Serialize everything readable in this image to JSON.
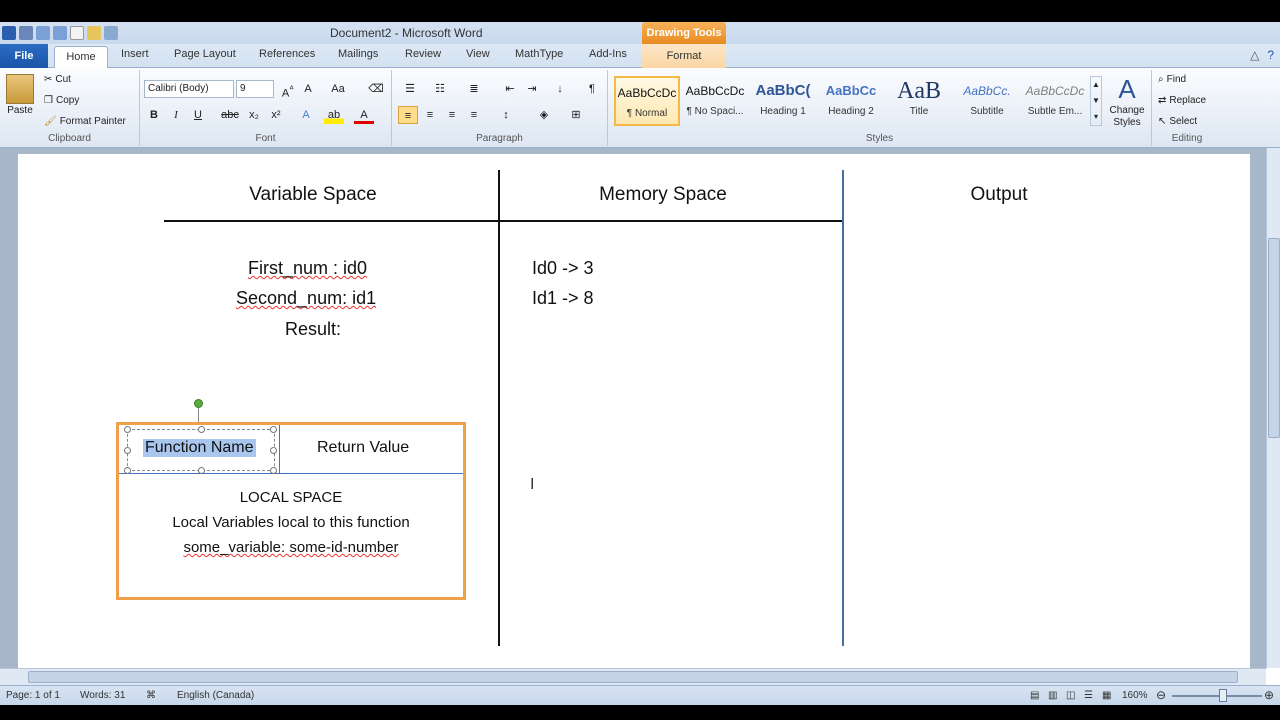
{
  "window": {
    "title": "Document2 - Microsoft Word",
    "contextual_tab_group": "Drawing Tools"
  },
  "tabs": [
    "File",
    "Home",
    "Insert",
    "Page Layout",
    "References",
    "Mailings",
    "Review",
    "View",
    "MathType",
    "Add-Ins",
    "Format"
  ],
  "ribbon": {
    "clipboard": {
      "paste": "Paste",
      "cut": "Cut",
      "copy": "Copy",
      "format_painter": "Format Painter",
      "label": "Clipboard"
    },
    "font": {
      "font_name": "Calibri (Body)",
      "font_size": "9",
      "label": "Font"
    },
    "paragraph": {
      "label": "Paragraph"
    },
    "styles": {
      "label": "Styles",
      "items": [
        {
          "sample": "AaBbCcDc",
          "name": "¶ Normal"
        },
        {
          "sample": "AaBbCcDc",
          "name": "¶ No Spaci..."
        },
        {
          "sample": "AaBbC(",
          "name": "Heading 1"
        },
        {
          "sample": "AaBbCc",
          "name": "Heading 2"
        },
        {
          "sample": "AaB",
          "name": "Title"
        },
        {
          "sample": "AaBbCc.",
          "name": "Subtitle"
        },
        {
          "sample": "AaBbCcDc",
          "name": "Subtle Em..."
        }
      ],
      "change_styles": "Change Styles"
    },
    "editing": {
      "find": "Find",
      "replace": "Replace",
      "select": "Select",
      "label": "Editing"
    }
  },
  "document": {
    "headers": {
      "variable_space": "Variable Space",
      "memory_space": "Memory Space",
      "output": "Output"
    },
    "variables": {
      "first": "First_num : id0",
      "second": "Second_num: id1",
      "result": "Result:"
    },
    "memory": {
      "id0": "Id0 -> 3",
      "id1": "Id1 -> 8"
    },
    "function_box": {
      "name": "Function Name",
      "return_value": "Return Value",
      "local_title": "LOCAL SPACE",
      "local_desc": "Local Variables local to this function",
      "local_var": "some_variable: some-id-number"
    }
  },
  "statusbar": {
    "page": "Page: 1 of 1",
    "words": "Words: 31",
    "language": "English (Canada)",
    "zoom": "160%"
  }
}
